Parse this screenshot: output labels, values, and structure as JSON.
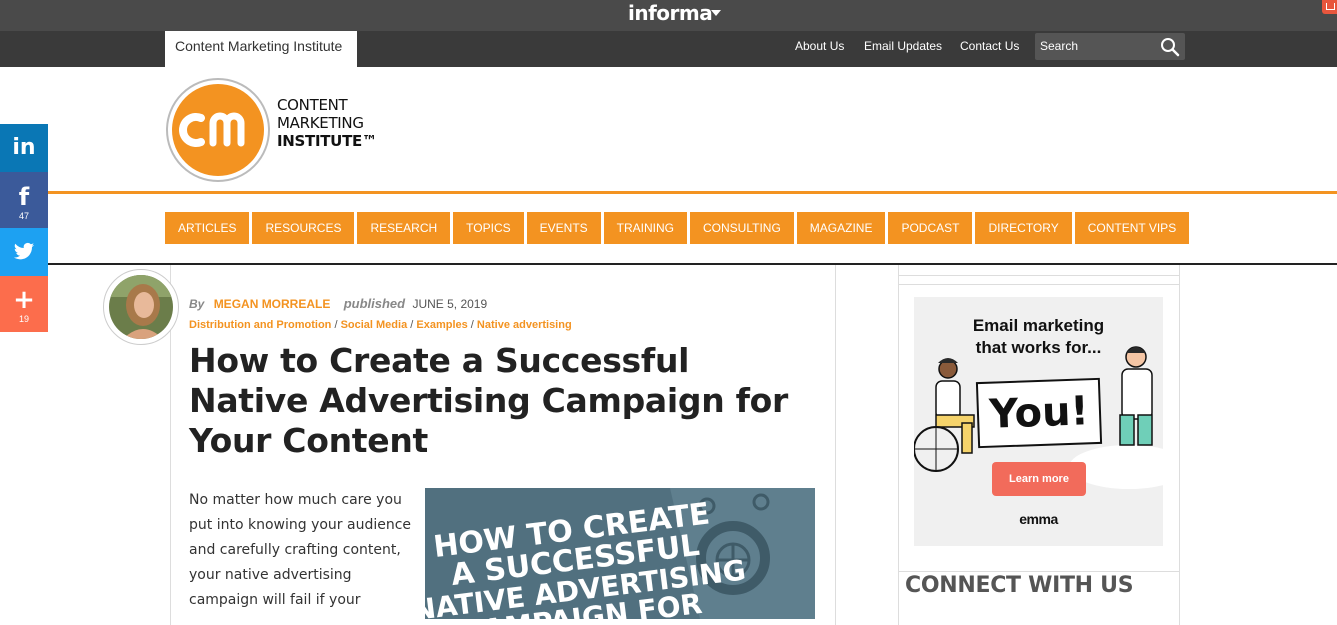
{
  "top_bar": {
    "brand": "informa"
  },
  "site_bar": {
    "site_tab": "Content Marketing Institute",
    "links": [
      "About Us",
      "Email Updates",
      "Contact Us"
    ],
    "search_placeholder": "Search"
  },
  "header": {
    "logo_lines": [
      "CONTENT",
      "MARKETING",
      "INSTITUTE™"
    ]
  },
  "nav": [
    "ARTICLES",
    "RESOURCES",
    "RESEARCH",
    "TOPICS",
    "EVENTS",
    "TRAINING",
    "CONSULTING",
    "MAGAZINE",
    "PODCAST",
    "DIRECTORY",
    "CONTENT VIPS"
  ],
  "social": {
    "facebook_count": "47",
    "share_count": "19"
  },
  "article": {
    "by": "By",
    "author": "MEGAN MORREALE",
    "published_label": "published",
    "date": "JUNE 5, 2019",
    "categories": [
      "Distribution and Promotion",
      "Social Media",
      "Examples",
      "Native advertising"
    ],
    "title": "How to Create a Successful Native Advertising Campaign for Your Content",
    "intro": "No matter how much care you put into knowing your audience and carefully crafting content, your native advertising campaign will fail if your",
    "hero_text": [
      "HOW TO CREATE",
      "A SUCCESSFUL",
      "NATIVE ADVERTISING",
      "CAMPAIGN FOR"
    ]
  },
  "sidebar": {
    "ad": {
      "title_line1": "Email marketing",
      "title_line2": "that works for...",
      "sign": "You!",
      "button": "Learn more",
      "brand": "emma"
    },
    "connect_heading": "CONNECT WITH US"
  },
  "colors": {
    "accent": "#f39321",
    "linkedin": "#0a77b5",
    "facebook": "#3b5a9a",
    "twitter": "#1da1f2",
    "share": "#fc6d4c"
  }
}
